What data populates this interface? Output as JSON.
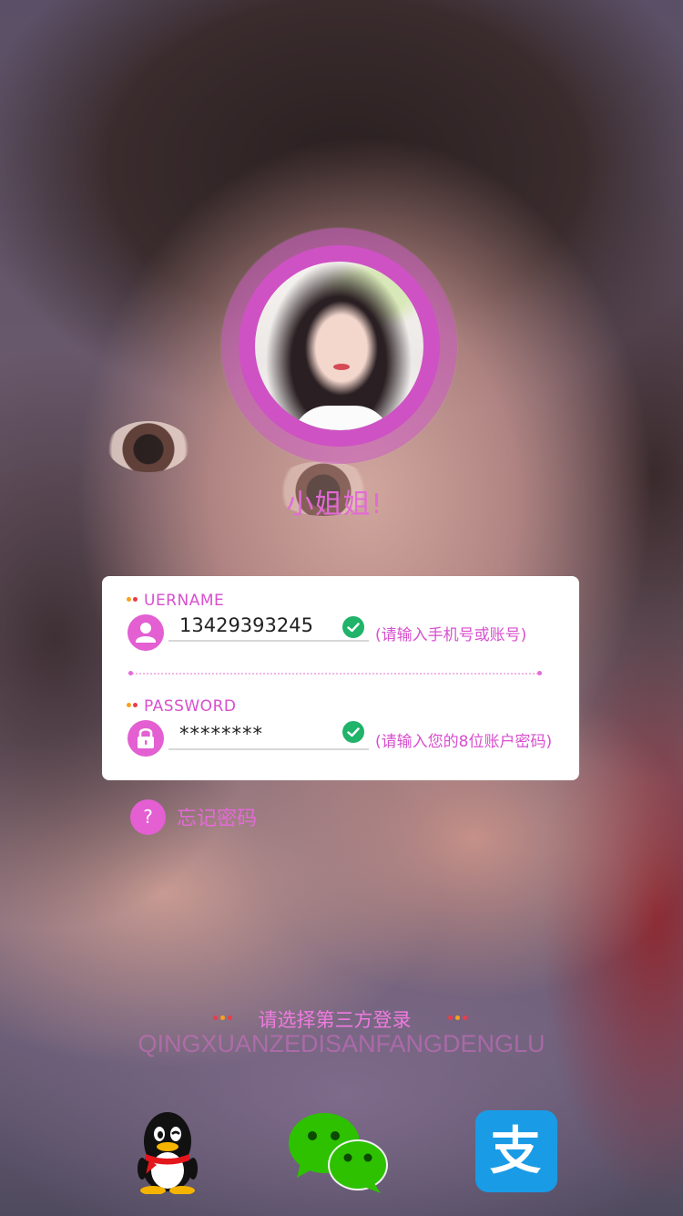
{
  "profile": {
    "nickname": "小姐姐!"
  },
  "login": {
    "username_label": "UERNAME",
    "username_value": "13429393245",
    "username_hint": "(请输入手机号或账号)",
    "password_label": "PASSWORD",
    "password_value": "********",
    "password_hint": "(请输入您的8位账户密码)",
    "forgot_label": "忘记密码",
    "forgot_icon_glyph": "?"
  },
  "third_party": {
    "title": "请选择第三方登录",
    "pinyin": "QINGXUANZEDISANFANGDENGLU",
    "providers": [
      {
        "icon": "qq-penguin-icon"
      },
      {
        "icon": "wechat-icon"
      },
      {
        "icon": "alipay-icon",
        "glyph": "支"
      }
    ]
  },
  "colors": {
    "accent": "#e35fd2",
    "accent_text": "#d84fcf",
    "check_green": "#20b36a",
    "wechat_green": "#2dc100",
    "alipay_blue": "#1a9be6",
    "dot_orange": "#f7a21b",
    "dot_red": "#ec3b4c",
    "dot_pink": "#e76ad9"
  }
}
